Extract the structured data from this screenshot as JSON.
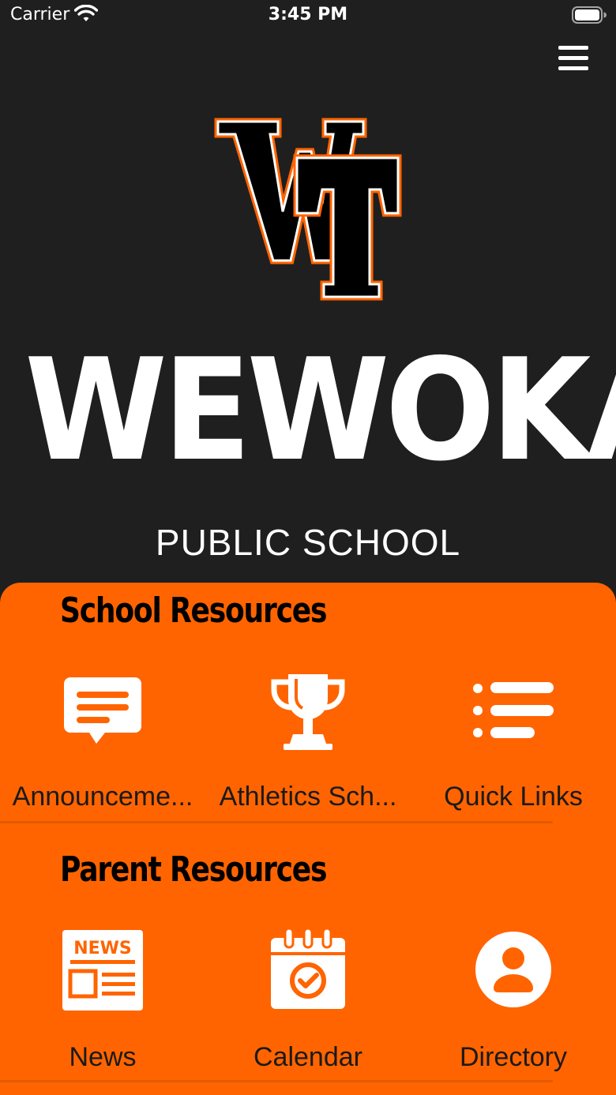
{
  "status_bar": {
    "carrier": "Carrier",
    "time": "3:45 PM"
  },
  "logo": {
    "monogram": "WT",
    "wordmark": "WEWOKA",
    "tagline": "PUBLIC SCHOOL",
    "colors": {
      "primary": "#000000",
      "accent": "#ff6400",
      "outline": "#ffffff"
    }
  },
  "sections": {
    "school": {
      "title": "School Resources",
      "items": [
        {
          "label": "Announceme...",
          "icon": "message-icon"
        },
        {
          "label": "Athletics Sch...",
          "icon": "trophy-icon"
        },
        {
          "label": "Quick Links",
          "icon": "list-icon"
        }
      ]
    },
    "parent": {
      "title": "Parent Resources",
      "items": [
        {
          "label": "News",
          "icon": "newspaper-icon"
        },
        {
          "label": "Calendar",
          "icon": "calendar-icon"
        },
        {
          "label": "Directory",
          "icon": "person-icon"
        }
      ]
    }
  },
  "theme": {
    "background": "#1f1f1f",
    "panel": "#ff6400",
    "icon_color": "#ffffff",
    "text_color": "#1a1a1a"
  }
}
